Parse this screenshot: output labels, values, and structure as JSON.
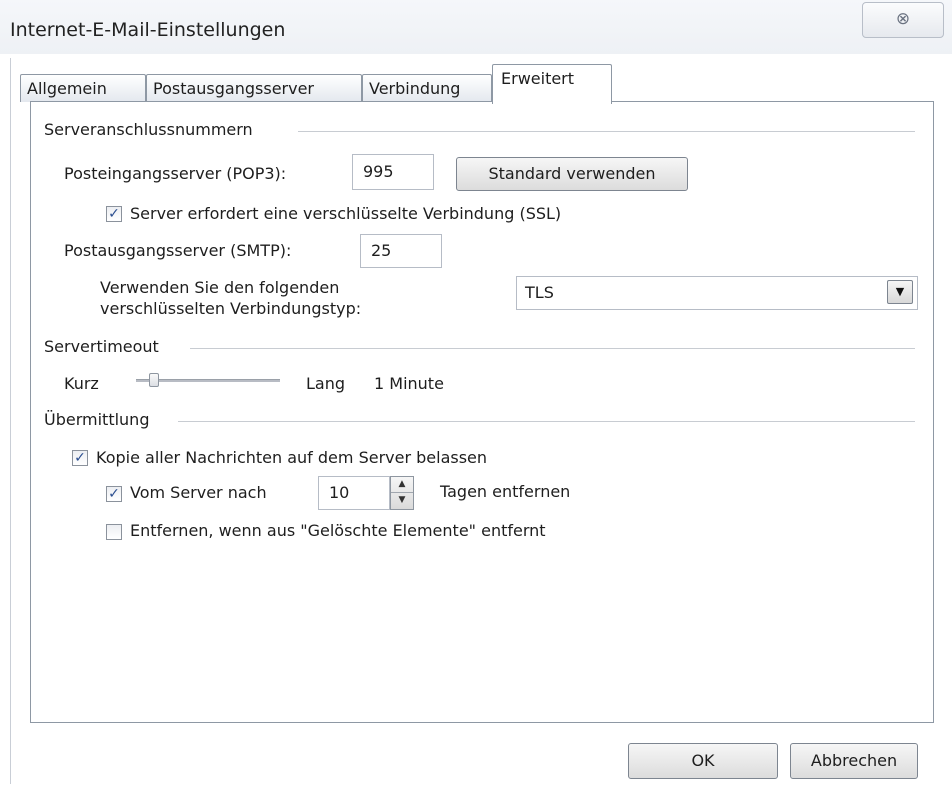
{
  "window": {
    "title": "Internet-E-Mail-Einstellungen",
    "close_glyph": "⊗"
  },
  "tabs": [
    {
      "label": "Allgemein"
    },
    {
      "label": "Postausgangsserver"
    },
    {
      "label": "Verbindung"
    },
    {
      "label": "Erweitert",
      "active": true
    }
  ],
  "server_ports": {
    "section_title": "Serveranschlussnummern",
    "pop3_label": "Posteingangsserver (POP3):",
    "pop3_value": "995",
    "default_button": "Standard verwenden",
    "ssl_label": "Server erfordert eine verschlüsselte Verbindung (SSL)",
    "ssl_checked": true,
    "smtp_label": "Postausgangsserver (SMTP):",
    "smtp_value": "25",
    "encryption_label_line1": "Verwenden Sie den folgenden",
    "encryption_label_line2": "verschlüsselten Verbindungstyp:",
    "encryption_value": "TLS"
  },
  "timeout": {
    "section_title": "Servertimeout",
    "short_label": "Kurz",
    "long_label": "Lang",
    "value_text": "1 Minute",
    "slider_fraction": 0.1
  },
  "delivery": {
    "section_title": "Übermittlung",
    "keep_copy_label": "Kopie aller Nachrichten auf dem Server belassen",
    "keep_copy_checked": true,
    "remove_after_label": "Vom Server nach",
    "remove_after_checked": true,
    "days_value": "10",
    "days_suffix": "Tagen entfernen",
    "remove_deleted_label": "Entfernen, wenn aus \"Gelöschte Elemente\" entfernt",
    "remove_deleted_checked": false
  },
  "footer": {
    "ok_label": "OK",
    "cancel_label": "Abbrechen"
  },
  "icons": {
    "check_glyph": "✓",
    "dropdown_glyph": "▼",
    "spin_up_glyph": "▲",
    "spin_down_glyph": "▼"
  }
}
